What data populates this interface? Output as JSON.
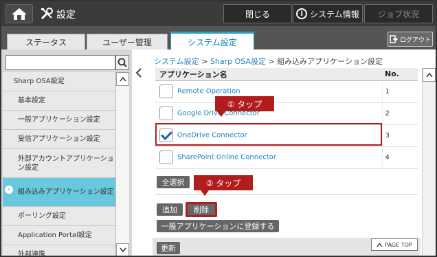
{
  "header": {
    "title": "設定",
    "close_label": "閉じる",
    "sysinfo_label": "システム情報",
    "job_label": "ジョブ状況",
    "icons": [
      "home-icon",
      "tools-icon",
      "info-icon"
    ]
  },
  "tabs": {
    "status": "ステータス",
    "users": "ユーザー管理",
    "system": "システム設定",
    "logout": "ログアウト"
  },
  "sidebar": {
    "items": [
      {
        "label": "Sharp OSA設定"
      },
      {
        "label": "基本設定"
      },
      {
        "label": "一般アプリケーション設定"
      },
      {
        "label": "受信アプリケーション設定"
      },
      {
        "label": "外部アカウントアプリケーション設定"
      },
      {
        "label": "組み込みアプリケーション設定",
        "active": true
      },
      {
        "label": "ポーリング設定"
      },
      {
        "label": "Application Portal設定"
      },
      {
        "label": "外部連携"
      }
    ]
  },
  "breadcrumb": {
    "level1": "システム設定",
    "level2": "Sharp OSA設定",
    "level3": "組み込みアプリケーション設定",
    "sep": ">"
  },
  "table": {
    "header_name": "アプリケーション名",
    "header_no": "No.",
    "rows": [
      {
        "name": "Remote Operation",
        "no": "1",
        "checked": false
      },
      {
        "name": "Google Drive Connector",
        "no": "2",
        "checked": false
      },
      {
        "name": "OneDrive Connector",
        "no": "3",
        "checked": true
      },
      {
        "name": "SharePoint Online Connector",
        "no": "4",
        "checked": false
      }
    ]
  },
  "actions": {
    "select_all": "全選択",
    "add": "追加",
    "delete": "削除",
    "register": "一般アプリケーションに登録する",
    "refresh": "更新",
    "page_top": "PAGE TOP"
  },
  "annotations": {
    "step1": "① タップ",
    "step2": "② タップ",
    "color": "#b11c1c"
  }
}
